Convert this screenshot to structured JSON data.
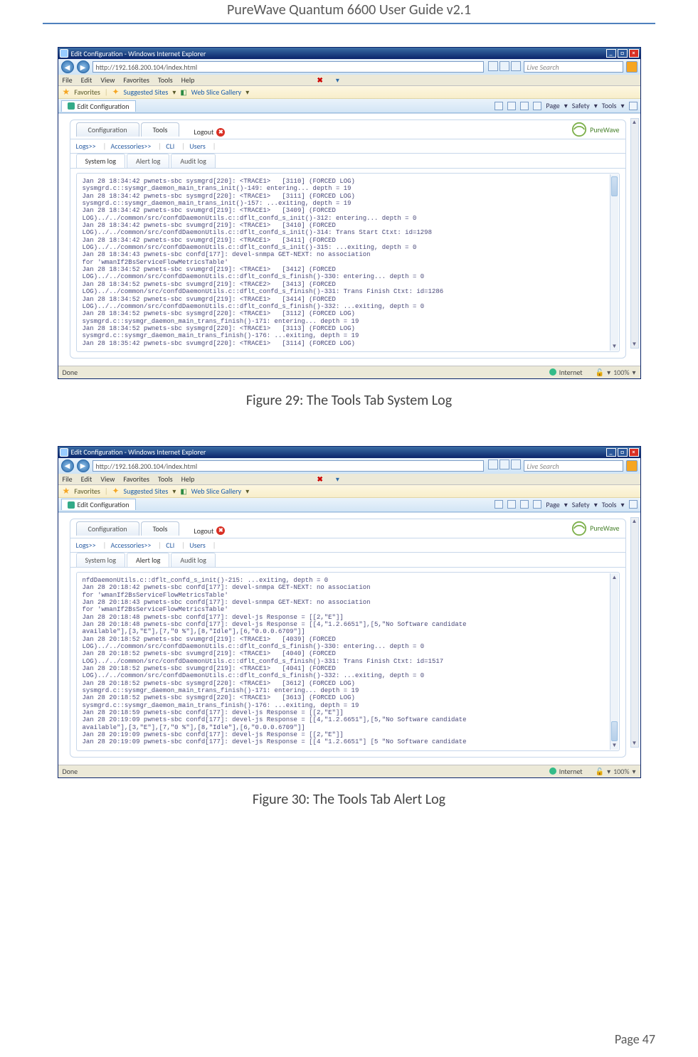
{
  "doc": {
    "title": "PureWave Quantum 6600 User Guide v2.1",
    "page_label": "Page 47"
  },
  "captions": {
    "fig29": "Figure 29: The Tools Tab System Log",
    "fig30": "Figure 30: The Tools Tab Alert Log"
  },
  "ie": {
    "window_title": "Edit Configuration - Windows Internet Explorer",
    "address": "http://192.168.200.104/index.html",
    "search_placeholder": "Live Search",
    "menus": [
      "File",
      "Edit",
      "View",
      "Favorites",
      "Tools",
      "Help"
    ],
    "favorites_label": "Favorites",
    "suggested_sites": "Suggested Sites",
    "web_slice": "Web Slice Gallery",
    "tab_label": "Edit Configuration",
    "cmd_page": "Page",
    "cmd_safety": "Safety",
    "cmd_tools": "Tools",
    "status_done": "Done",
    "status_zone": "Internet",
    "status_zoom": "100%"
  },
  "pw": {
    "main_tabs": {
      "configuration": "Configuration",
      "tools": "Tools"
    },
    "logout": "Logout",
    "brand": "PureWave",
    "linkrow": {
      "logs": "Logs>>",
      "accessories": "Accessories>>",
      "cli": "CLI",
      "users": "Users"
    },
    "subtabs": {
      "system": "System log",
      "alert": "Alert log",
      "audit": "Audit log"
    }
  },
  "logs": {
    "system": "Jan 28 18:34:42 pwnets-sbc sysmgrd[220]: <TRACE1>   [3110] (FORCED LOG)\nsysmgrd.c::sysmgr_daemon_main_trans_init()-149: entering... depth = 19\nJan 28 18:34:42 pwnets-sbc sysmgrd[220]: <TRACE1>   [3111] (FORCED LOG)\nsysmgrd.c::sysmgr_daemon_main_trans_init()-157: ...exiting, depth = 19\nJan 28 18:34:42 pwnets-sbc svumgrd[219]: <TRACE1>   [3409] (FORCED\nLOG)../../common/src/confdDaemonUtils.c::dflt_confd_s_init()-312: entering... depth = 0\nJan 28 18:34:42 pwnets-sbc svumgrd[219]: <TRACE1>   [3410] (FORCED\nLOG)../../common/src/confdDaemonUtils.c::dflt_confd_s_init()-314: Trans Start Ctxt: id=1298\nJan 28 18:34:42 pwnets-sbc svumgrd[219]: <TRACE1>   [3411] (FORCED\nLOG)../../common/src/confdDaemonUtils.c::dflt_confd_s_init()-315: ...exiting, depth = 0\nJan 28 18:34:43 pwnets-sbc confd[177]: devel-snmpa GET-NEXT: no association\nfor 'wmanIf2BsServiceFlowMetricsTable'\nJan 28 18:34:52 pwnets-sbc svumgrd[219]: <TRACE1>   [3412] (FORCED\nLOG)../../common/src/confdDaemonUtils.c::dflt_confd_s_finish()-330: entering... depth = 0\nJan 28 18:34:52 pwnets-sbc svumgrd[219]: <TRACE2>   [3413] (FORCED\nLOG)../../common/src/confdDaemonUtils.c::dflt_confd_s_finish()-331: Trans Finish Ctxt: id=1286\nJan 28 18:34:52 pwnets-sbc svumgrd[219]: <TRACE1>   [3414] (FORCED\nLOG)../../common/src/confdDaemonUtils.c::dflt_confd_s_finish()-332: ...exiting, depth = 0\nJan 28 18:34:52 pwnets-sbc sysmgrd[220]: <TRACE1>   [3112] (FORCED LOG)\nsysmgrd.c::sysmgr_daemon_main_trans_finish()-171: entering... depth = 19\nJan 28 18:34:52 pwnets-sbc sysmgrd[220]: <TRACE1>   [3113] (FORCED LOG)\nsysmgrd.c::sysmgr_daemon_main_trans_finish()-176: ...exiting, depth = 19\nJan 28 18:35:42 pwnets-sbc svumgrd[220]: <TRACE1>   [3114] (FORCED LOG)",
    "alert": "nfdDaemonUtils.c::dflt_confd_s_init()-215: ...exiting, depth = 0\nJan 28 20:18:42 pwnets-sbc confd[177]: devel-snmpa GET-NEXT: no association\nfor 'wmanIf2BsServiceFlowMetricsTable'\nJan 28 20:18:43 pwnets-sbc confd[177]: devel-snmpa GET-NEXT: no association\nfor 'wmanIf2BsServiceFlowMetricsTable'\nJan 28 20:18:48 pwnets-sbc confd[177]: devel-js Response = [[2,\"E\"]]\nJan 28 20:18:48 pwnets-sbc confd[177]: devel-js Response = [[4,\"1.2.6651\"],[5,\"No Software candidate\navailable\"],[3,\"E\"],[7,\"0 %\"],[8,\"Idle\"],[6,\"0.0.0.6709\"]]\nJan 28 20:18:52 pwnets-sbc svumgrd[219]: <TRACE1>   [4039] (FORCED\nLOG)../../common/src/confdDaemonUtils.c::dflt_confd_s_finish()-330: entering... depth = 0\nJan 28 20:18:52 pwnets-sbc svumgrd[219]: <TRACE1>   [4040] (FORCED\nLOG)../../common/src/confdDaemonUtils.c::dflt_confd_s_finish()-331: Trans Finish Ctxt: id=1517\nJan 28 20:18:52 pwnets-sbc svumgrd[219]: <TRACE1>   [4041] (FORCED\nLOG)../../common/src/confdDaemonUtils.c::dflt_confd_s_finish()-332: ...exiting, depth = 0\nJan 28 20:18:52 pwnets-sbc sysmgrd[220]: <TRACE1>   [3612] (FORCED LOG)\nsysmgrd.c::sysmgr_daemon_main_trans_finish()-171: entering... depth = 19\nJan 28 20:18:52 pwnets-sbc sysmgrd[220]: <TRACE1>   [3613] (FORCED LOG)\nsysmgrd.c::sysmgr_daemon_main_trans_finish()-176: ...exiting, depth = 19\nJan 28 20:18:59 pwnets-sbc confd[177]: devel-js Response = [[2,\"E\"]]\nJan 28 20:19:09 pwnets-sbc confd[177]: devel-js Response = [[4,\"1.2.6651\"],[5,\"No Software candidate\navailable\"],[3,\"E\"],[7,\"0 %\"],[8,\"Idle\"],[6,\"0.0.0.6709\"]]\nJan 28 20:19:09 pwnets-sbc confd[177]: devel-js Response = [[2,\"E\"]]\nJan 28 20:19:09 pwnets-sbc confd[177]: devel-js Response = [[4 \"1.2.6651\"] [5 \"No Software candidate"
  }
}
